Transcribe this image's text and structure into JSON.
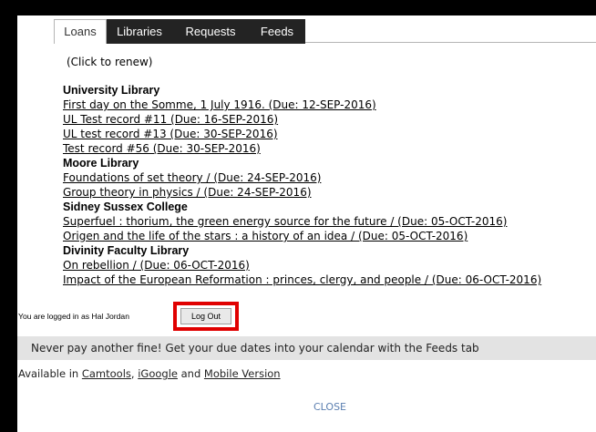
{
  "tabs": [
    "Loans",
    "Libraries",
    "Requests",
    "Feeds"
  ],
  "click_renew": "(Click to renew)",
  "libraries": [
    {
      "name": "University Library",
      "loans": [
        "First day on the Somme, 1 July 1916. (Due: 12-SEP-2016)",
        "UL Test record #11 (Due: 16-SEP-2016)",
        "UL test record #13 (Due: 30-SEP-2016)",
        "Test record #56 (Due: 30-SEP-2016)"
      ]
    },
    {
      "name": "Moore Library",
      "loans": [
        "Foundations of set theory / (Due: 24-SEP-2016)",
        "Group theory in physics / (Due: 24-SEP-2016)"
      ]
    },
    {
      "name": "Sidney Sussex College",
      "loans": [
        "Superfuel : thorium, the green energy source for the future / (Due: 05-OCT-2016)",
        "Origen and the life of the stars : a history of an idea / (Due: 05-OCT-2016)"
      ]
    },
    {
      "name": "Divinity Faculty Library",
      "loans": [
        "On rebellion / (Due: 06-OCT-2016)",
        "Impact of the European Reformation : princes, clergy, and people / (Due: 06-OCT-2016)"
      ]
    }
  ],
  "login": {
    "text": "You are logged in as Hal Jordan",
    "logout_label": "Log Out"
  },
  "promo": "Never pay another fine! Get your due dates into your calendar with the Feeds tab",
  "available": {
    "prefix": "Available in ",
    "camtools": "Camtools",
    "sep1": ", ",
    "igoogle": "iGoogle",
    "sep2": " and ",
    "mobile": "Mobile Version"
  },
  "close_label": "CLOSE",
  "colors": {
    "highlight": "#e00000",
    "dark_tab": "#232323",
    "close_link": "#5b7fb0",
    "promo_bg": "#e3e3e3"
  }
}
